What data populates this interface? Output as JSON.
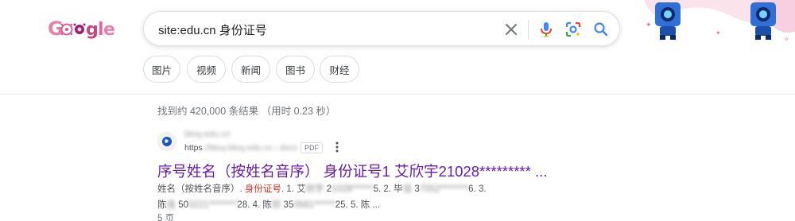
{
  "logo": {
    "letters": [
      "G",
      "o",
      "o",
      "g",
      "l",
      "e"
    ]
  },
  "search": {
    "query": "site:edu.cn 身份证号"
  },
  "filters": [
    "图片",
    "视频",
    "新闻",
    "图书",
    "财经"
  ],
  "stats": "找到约 420,000 条结果 （用时 0.23 秒）",
  "result": {
    "site_name": "bksy.edu.cn",
    "url_prefix": "https",
    "url_hidden": "://bksy.bksy.edu.cn › docs",
    "file_type": "PDF",
    "title": "序号姓名（按姓名音序） 身份证号1 艾欣宇21028********* ...",
    "snippet": {
      "line1_a": "姓名（按姓名音序）. ",
      "highlight": "身份证号",
      "line1_b": ". 1. 艾",
      "blur1": "欣宇",
      "line1_c": " 2",
      "blur2": "1028******",
      "line1_d": "5. 2. 毕",
      "blur3": "佳",
      "line1_e": " 3",
      "blur4": "7052********",
      "line1_f": "6. 3.",
      "line2_a": "陈",
      "blur5": "佳",
      "line2_b": " 50",
      "blur6": "0221********",
      "line2_c": "28. 4. 陈",
      "blur7": "欣",
      "line2_d": " 35",
      "blur8": "0581******",
      "line2_e": "25. 5. 陈 ..."
    },
    "pages": "5 页"
  }
}
